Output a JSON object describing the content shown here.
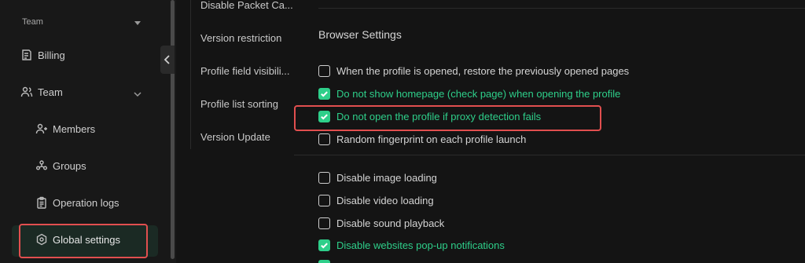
{
  "sidebar": {
    "team_header": "Team",
    "billing": "Billing",
    "team": "Team",
    "members": "Members",
    "groups": "Groups",
    "operation_logs": "Operation logs",
    "global_settings": "Global settings"
  },
  "midnav": {
    "items": [
      "Disable Packet Ca...",
      "Version restriction",
      "Profile field visibili...",
      "Profile list sorting",
      "Version Update"
    ]
  },
  "browser_settings": {
    "title": "Browser Settings",
    "options": [
      {
        "label": "When the profile is opened, restore the previously opened pages",
        "checked": false
      },
      {
        "label": "Do not show homepage (check page) when opening the profile",
        "checked": true
      },
      {
        "label": "Do not open the profile if proxy detection fails",
        "checked": true
      },
      {
        "label": "Random fingerprint on each profile launch",
        "checked": false
      }
    ]
  },
  "loading_settings": {
    "options": [
      {
        "label": "Disable image loading",
        "checked": false
      },
      {
        "label": "Disable video loading",
        "checked": false
      },
      {
        "label": "Disable sound playback",
        "checked": false
      },
      {
        "label": "Disable websites pop-up notifications",
        "checked": true
      }
    ]
  },
  "colors": {
    "accent": "#2ecf8a",
    "highlight": "#e14f4f",
    "background": "#141414"
  }
}
